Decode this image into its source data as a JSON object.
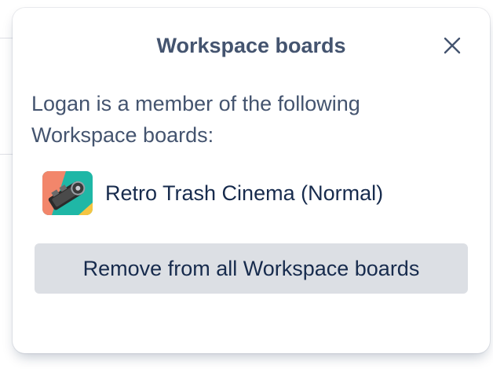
{
  "popover": {
    "title": "Workspace boards",
    "close_icon": "close-icon",
    "description": "Logan is a member of the following Workspace boards:",
    "boards": [
      {
        "name": "Retro Trash Cinema (Normal)",
        "thumbnail_icon": "film-projector-thumbnail"
      }
    ],
    "remove_button_label": "Remove from all Workspace boards"
  },
  "colors": {
    "title_text": "#44546f",
    "body_text": "#172b4d",
    "button_bg": "#dcdfe4",
    "thumb_teal": "#1fb7a6",
    "thumb_coral": "#f2866b",
    "thumb_yellow": "#f5c542"
  }
}
